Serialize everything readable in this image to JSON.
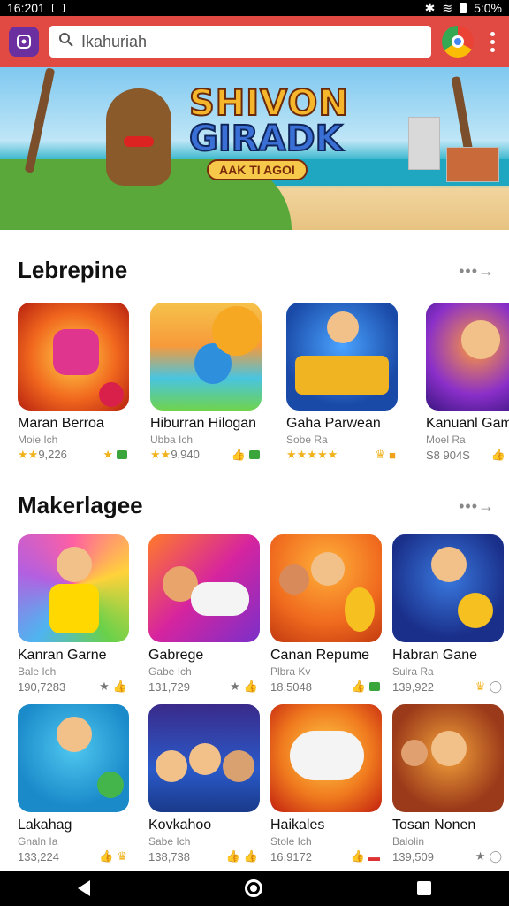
{
  "status": {
    "time": "16:201",
    "battery": "5:0%"
  },
  "search": {
    "value": "Ikahuriah"
  },
  "banner": {
    "title_line1": "SHIVON",
    "title_line2": "GIRADK",
    "ribbon": "AAK TI AGOI"
  },
  "sections": [
    {
      "title": "Lebrepine",
      "more": "•••→",
      "apps": [
        {
          "name": "Maran Berroa",
          "dev": "Moie Ich",
          "meta": "9,226",
          "stars": "★★",
          "icon1": "star-icon",
          "icon2": "green-badge-icon"
        },
        {
          "name": "Hiburran Hilogan",
          "dev": "Ubba Ich",
          "meta": "9,940",
          "stars": "★★",
          "icon1": "thumb-icon",
          "icon2": "green-badge-icon"
        },
        {
          "name": "Gaha Parwean",
          "dev": "Sobe Ra",
          "meta": "",
          "stars": "★★★★★",
          "icon1": "crown-icon",
          "icon2": "bag-icon"
        },
        {
          "name": "Kanuanl Gamr",
          "dev": "Moel Ra",
          "meta": "S8 904S",
          "stars": "",
          "icon1": "thumb-icon",
          "icon2": ""
        }
      ]
    },
    {
      "title": "Makerlagee",
      "more": "•••→",
      "apps": [
        {
          "name": "Kanran Garne",
          "dev": "Bale Ich",
          "meta": "190,7283",
          "stars": "",
          "icon1": "star-icon",
          "icon2": "thumb-icon"
        },
        {
          "name": "Gabrege",
          "dev": "Gabe Ich",
          "meta": "131,729",
          "stars": "",
          "icon1": "star-icon",
          "icon2": "thumb-icon"
        },
        {
          "name": "Canan Repume",
          "dev": "Plbra Kv",
          "meta": "18,5048",
          "stars": "",
          "icon1": "thumb-icon",
          "icon2": "green-badge-icon"
        },
        {
          "name": "Habran Gane",
          "dev": "Sulra Ra",
          "meta": "139,922",
          "stars": "",
          "icon1": "crown-icon",
          "icon2": "circle-icon"
        }
      ]
    },
    {
      "title": "",
      "more": "",
      "apps": [
        {
          "name": "Lakahag",
          "dev": "Gnaln Ia",
          "meta": "133,224",
          "stars": "",
          "icon1": "thumb-icon",
          "icon2": "crown-icon"
        },
        {
          "name": "Kovkahoo",
          "dev": "Sabe Ich",
          "meta": "138,738",
          "stars": "",
          "icon1": "thumb-icon",
          "icon2": "thumb-icon"
        },
        {
          "name": "Haikales",
          "dev": "Stole Ich",
          "meta": "16,9172",
          "stars": "",
          "icon1": "thumb-icon",
          "icon2": "red-badge-icon"
        },
        {
          "name": "Tosan Nonen",
          "dev": "Balolin",
          "meta": "139,509",
          "stars": "",
          "icon1": "star-icon",
          "icon2": "circle-icon"
        }
      ]
    }
  ],
  "colors": {
    "appbar": "#e04a43",
    "accent": "#6b2fa0"
  }
}
